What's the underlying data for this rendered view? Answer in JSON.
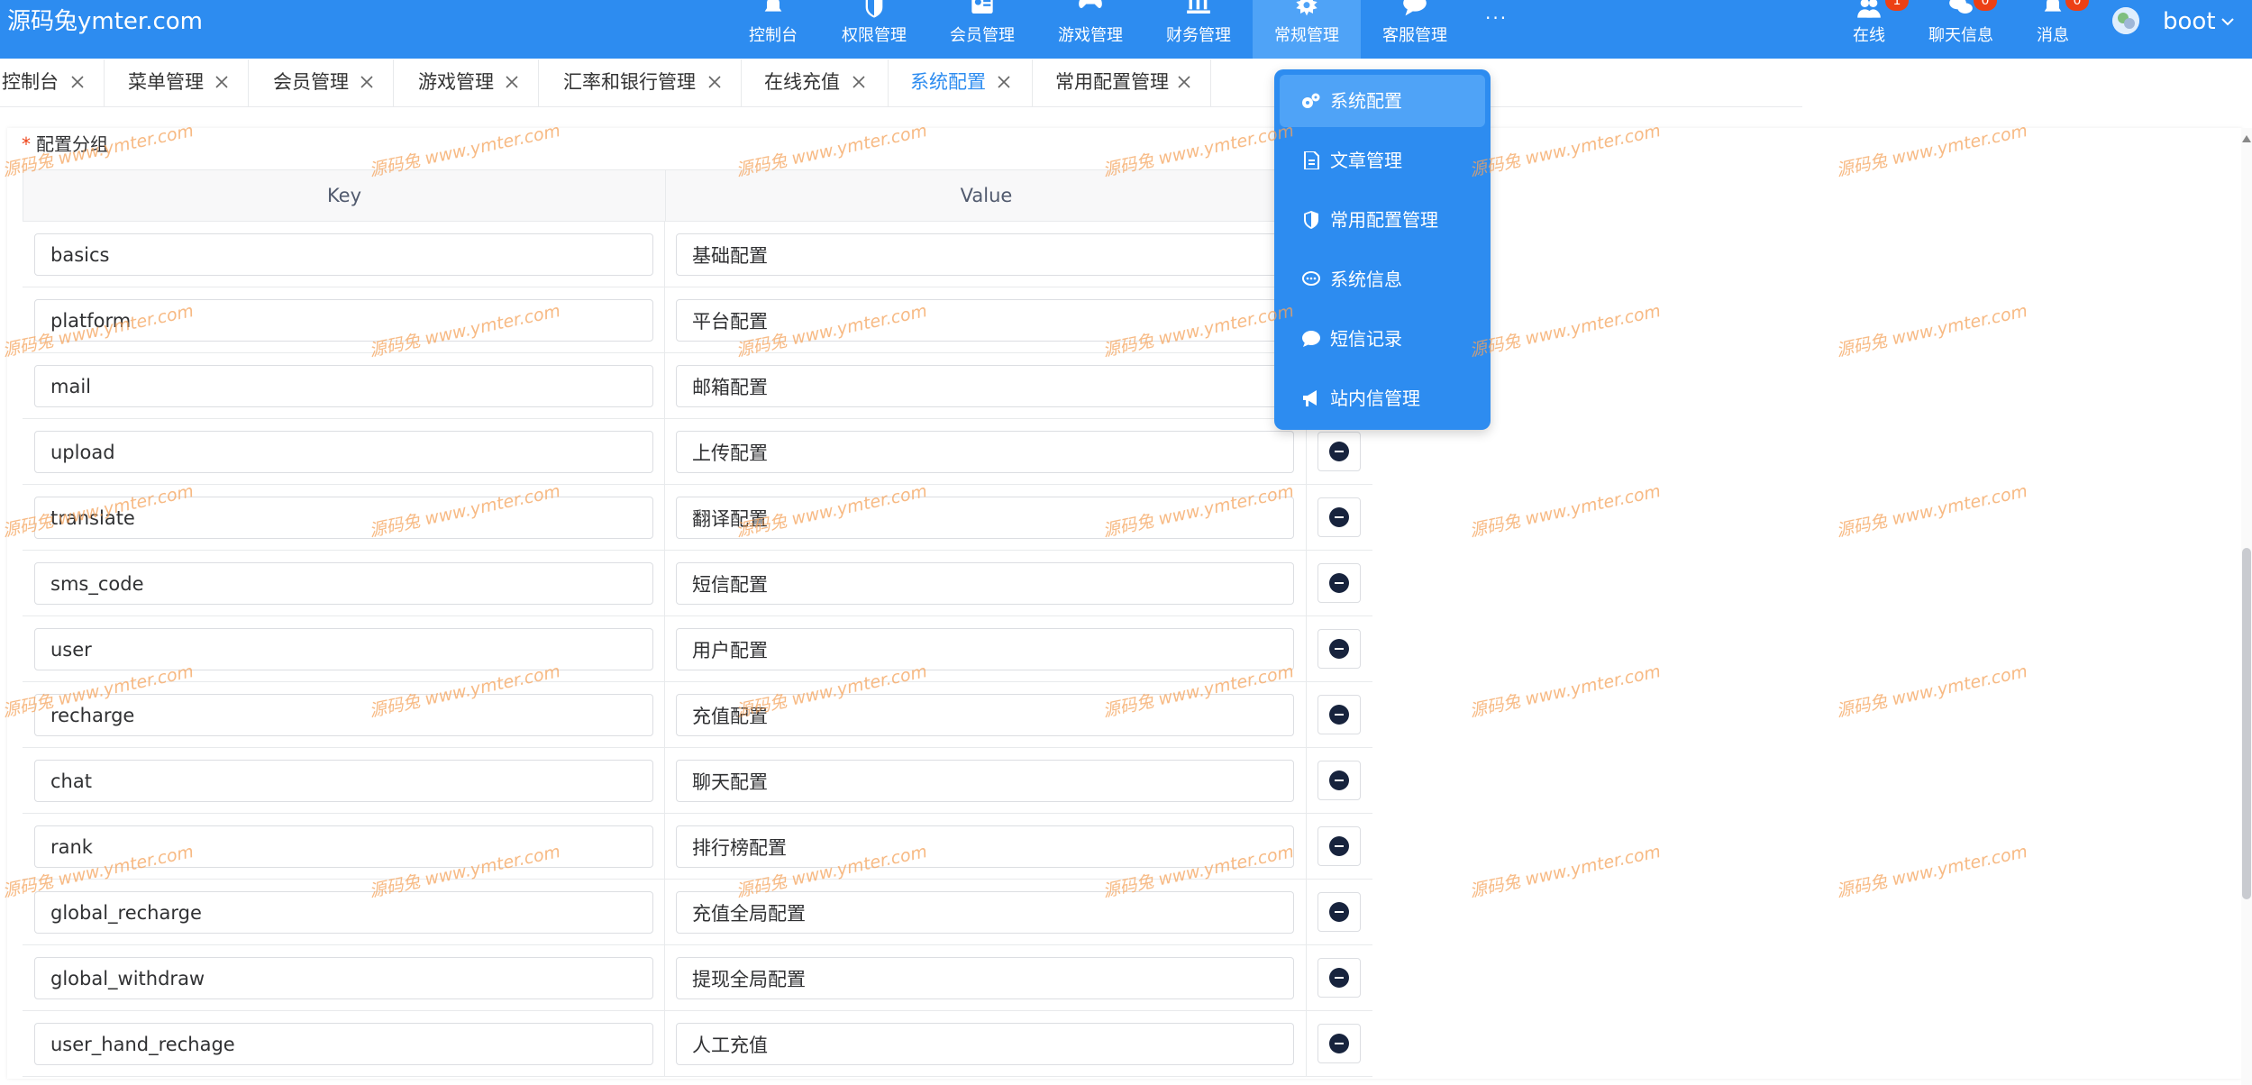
{
  "brand": {
    "title": "源码兔ymter.com"
  },
  "nav": {
    "items": [
      {
        "label": "控制台",
        "icon": "bell-icon"
      },
      {
        "label": "权限管理",
        "icon": "shield-icon"
      },
      {
        "label": "会员管理",
        "icon": "id-card-icon"
      },
      {
        "label": "游戏管理",
        "icon": "gamepad-icon"
      },
      {
        "label": "财务管理",
        "icon": "bank-icon"
      },
      {
        "label": "常规管理",
        "icon": "gear-icon",
        "active": true
      },
      {
        "label": "客服管理",
        "icon": "chat-icon"
      }
    ],
    "more": "···"
  },
  "header_right": {
    "online": {
      "label": "在线",
      "badge": "1",
      "icon": "users-icon"
    },
    "chat": {
      "label": "聊天信息",
      "badge": "0",
      "icon": "chat-bubbles-icon"
    },
    "messages": {
      "label": "消息",
      "badge": "0",
      "icon": "bell-icon"
    },
    "username": "boot"
  },
  "tabs": [
    {
      "label": "控制台"
    },
    {
      "label": "菜单管理"
    },
    {
      "label": "会员管理"
    },
    {
      "label": "游戏管理"
    },
    {
      "label": "汇率和银行管理"
    },
    {
      "label": "在线充值"
    },
    {
      "label": "系统配置",
      "active": true
    },
    {
      "label": "常用配置管理"
    }
  ],
  "form": {
    "group_label": "配置分组",
    "required_mark": "*",
    "columns": {
      "key": "Key",
      "value": "Value"
    },
    "rows": [
      {
        "key": "basics",
        "value": "基础配置"
      },
      {
        "key": "platform",
        "value": "平台配置"
      },
      {
        "key": "mail",
        "value": "邮箱配置"
      },
      {
        "key": "upload",
        "value": "上传配置"
      },
      {
        "key": "translate",
        "value": "翻译配置"
      },
      {
        "key": "sms_code",
        "value": "短信配置"
      },
      {
        "key": "user",
        "value": "用户配置"
      },
      {
        "key": "recharge",
        "value": "充值配置"
      },
      {
        "key": "chat",
        "value": "聊天配置"
      },
      {
        "key": "rank",
        "value": "排行榜配置"
      },
      {
        "key": "global_recharge",
        "value": "充值全局配置"
      },
      {
        "key": "global_withdraw",
        "value": "提现全局配置"
      },
      {
        "key": "user_hand_rechage",
        "value": "人工充值"
      }
    ]
  },
  "dropdown": {
    "items": [
      {
        "label": "系统配置",
        "icon": "gears-icon",
        "active": true
      },
      {
        "label": "文章管理",
        "icon": "document-icon"
      },
      {
        "label": "常用配置管理",
        "icon": "shield-icon"
      },
      {
        "label": "系统信息",
        "icon": "comment-icon"
      },
      {
        "label": "短信记录",
        "icon": "message-icon"
      },
      {
        "label": "站内信管理",
        "icon": "megaphone-icon"
      }
    ]
  },
  "watermark": {
    "text": "源码兔 www.ymter.com"
  },
  "colors": {
    "primary": "#2d8cf0",
    "active": "#4fa3f7",
    "badge": "#ed4014",
    "watermark": "#f5a35c"
  }
}
